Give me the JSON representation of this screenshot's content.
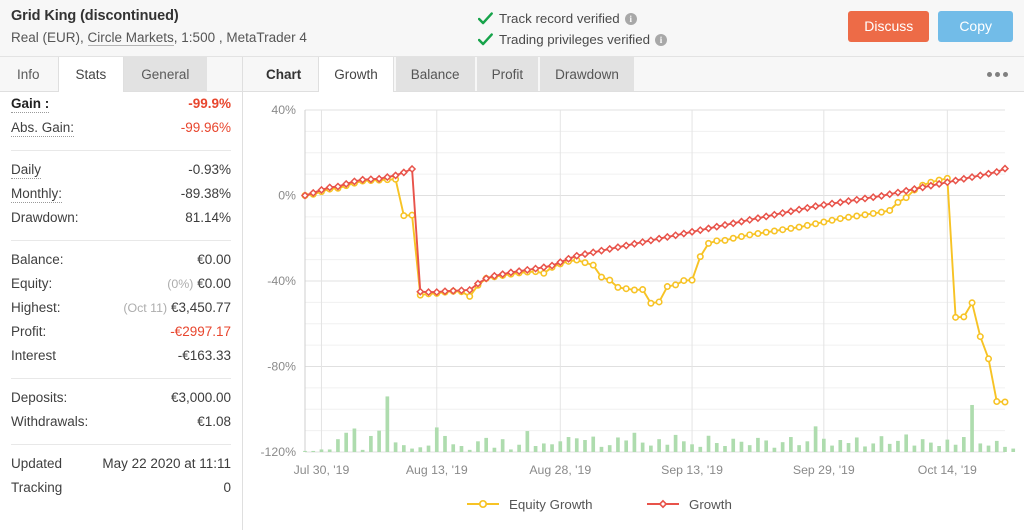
{
  "header": {
    "account_name": "Grid King (discontinued)",
    "account_type": "Real (EUR),",
    "broker": "Circle Markets",
    "account_meta": ", 1:500 , MetaTrader 4",
    "verified": [
      {
        "label": "Track record verified",
        "icon": "check-icon",
        "info": "i"
      },
      {
        "label": "Trading privileges verified",
        "icon": "check-icon",
        "info": "i"
      }
    ],
    "buttons": {
      "discuss": "Discuss",
      "copy": "Copy"
    },
    "colors": {
      "discuss_bg": "#ed6b47",
      "copy_bg": "#72bce8",
      "check_green": "#16a34a"
    }
  },
  "sidebar": {
    "tabs": [
      {
        "label": "Info",
        "state": "plain"
      },
      {
        "label": "Stats",
        "state": "active"
      },
      {
        "label": "General",
        "state": "shaded"
      }
    ],
    "groups": [
      {
        "rows": [
          {
            "label": "Gain :",
            "value": "-99.9%",
            "style": "redb",
            "label_style": "bold dotted"
          },
          {
            "label": "Abs. Gain:",
            "value": "-99.96%",
            "style": "red",
            "label_style": "dotted"
          }
        ]
      },
      {
        "rows": [
          {
            "label": "Daily",
            "value": "-0.93%",
            "style": "",
            "label_style": "dotted"
          },
          {
            "label": "Monthly:",
            "value": "-89.38%",
            "style": "",
            "label_style": "dotted"
          },
          {
            "label": "Drawdown:",
            "value": "81.14%",
            "style": "",
            "label_style": ""
          }
        ]
      },
      {
        "rows": [
          {
            "label": "Balance:",
            "value": "€0.00",
            "style": "",
            "label_style": ""
          },
          {
            "label": "Equity:",
            "value": "€0.00",
            "prefix": "(0%)",
            "style": "",
            "label_style": ""
          },
          {
            "label": "Highest:",
            "value": "€3,450.77",
            "prefix": "(Oct 11)",
            "style": "",
            "label_style": ""
          },
          {
            "label": "Profit:",
            "value": "-€2997.17",
            "style": "red",
            "label_style": ""
          },
          {
            "label": "Interest",
            "value": "-€163.33",
            "style": "",
            "label_style": ""
          }
        ]
      },
      {
        "rows": [
          {
            "label": "Deposits:",
            "value": "€3,000.00",
            "style": "",
            "label_style": ""
          },
          {
            "label": "Withdrawals:",
            "value": "€1.08",
            "style": "",
            "label_style": ""
          }
        ]
      },
      {
        "rows": [
          {
            "label": "Updated",
            "value": "May 22 2020 at 11:11",
            "style": "",
            "label_style": ""
          },
          {
            "label": "Tracking",
            "value": "0",
            "style": "",
            "label_style": ""
          }
        ]
      }
    ]
  },
  "chart_panel": {
    "tabs": [
      {
        "label": "Chart",
        "state": "first"
      },
      {
        "label": "Growth",
        "state": "active"
      },
      {
        "label": "Balance",
        "state": "shaded"
      },
      {
        "label": "Profit",
        "state": "shaded"
      },
      {
        "label": "Drawdown",
        "state": "shaded"
      }
    ],
    "menu_icon": "more-options-icon"
  },
  "chart_data": {
    "type": "line",
    "title": "",
    "xlabel": "",
    "ylabel": "",
    "ylim": [
      -120,
      40
    ],
    "yticks": [
      40,
      0,
      -40,
      -80,
      -120
    ],
    "ytick_labels": [
      "40%",
      "0%",
      "-40%",
      "-80%",
      "-120%"
    ],
    "grid": true,
    "legend_position": "bottom",
    "xtick_labels": [
      "Jul 30, '19",
      "Aug 13, '19",
      "Aug 28, '19",
      "Sep 13, '19",
      "Sep 29, '19",
      "Oct 14, '19"
    ],
    "xtick_indices": [
      2,
      16,
      31,
      47,
      63,
      78
    ],
    "n_points": 86,
    "series": [
      {
        "name": "Growth",
        "color": "#e8534a",
        "marker": "diamond",
        "values": [
          0.0,
          1.2,
          2.6,
          3.8,
          4.2,
          5.4,
          6.6,
          7.4,
          7.6,
          7.8,
          8.6,
          9.4,
          10.8,
          12.4,
          -45.0,
          -45.2,
          -45.2,
          -44.8,
          -44.6,
          -44.4,
          -44.2,
          -41.2,
          -38.8,
          -37.6,
          -36.8,
          -36.0,
          -35.4,
          -34.8,
          -34.2,
          -33.6,
          -32.8,
          -31.2,
          -29.6,
          -28.2,
          -27.4,
          -26.6,
          -25.8,
          -25.0,
          -24.2,
          -23.4,
          -22.6,
          -21.8,
          -21.0,
          -20.2,
          -19.4,
          -18.6,
          -17.8,
          -17.0,
          -16.2,
          -15.4,
          -14.6,
          -13.8,
          -13.0,
          -12.2,
          -11.4,
          -10.6,
          -9.8,
          -9.0,
          -8.2,
          -7.4,
          -6.6,
          -5.8,
          -5.0,
          -4.4,
          -3.8,
          -3.2,
          -2.6,
          -2.0,
          -1.4,
          -0.8,
          -0.2,
          0.6,
          1.4,
          2.2,
          3.0,
          3.8,
          4.6,
          5.4,
          6.2,
          7.0,
          7.8,
          8.6,
          9.4,
          10.2,
          11.0,
          12.6,
          13.2
        ]
      },
      {
        "name": "Equity Growth",
        "color": "#f7c325",
        "marker": "circle",
        "values": [
          0.0,
          0.6,
          1.8,
          3.0,
          3.4,
          4.6,
          5.8,
          6.8,
          7.0,
          7.2,
          7.4,
          7.6,
          -9.4,
          -9.2,
          -46.6,
          -46.0,
          -45.8,
          -45.2,
          -44.8,
          -45.0,
          -47.2,
          -42.0,
          -38.8,
          -38.0,
          -37.4,
          -36.8,
          -36.2,
          -35.8,
          -35.6,
          -36.4,
          -33.6,
          -32.0,
          -30.8,
          -30.2,
          -31.4,
          -32.6,
          -38.2,
          -39.6,
          -43.0,
          -43.6,
          -44.2,
          -44.0,
          -50.4,
          -49.8,
          -42.6,
          -41.8,
          -39.8,
          -39.6,
          -28.6,
          -22.4,
          -21.2,
          -21.0,
          -20.0,
          -19.2,
          -18.4,
          -17.8,
          -17.2,
          -16.6,
          -16.0,
          -15.4,
          -14.8,
          -14.0,
          -13.2,
          -12.4,
          -11.6,
          -10.8,
          -10.2,
          -9.6,
          -9.0,
          -8.4,
          -7.8,
          -7.0,
          -3.2,
          -1.0,
          2.6,
          4.8,
          6.2,
          7.2,
          8.0,
          8.8,
          9.6,
          10.4,
          11.2,
          11.6,
          4.6,
          -57.0
        ],
        "tail": [
          -57.0,
          -56.8,
          -50.2,
          -66.0,
          -76.4,
          -96.4,
          -96.6
        ]
      }
    ],
    "bars": {
      "name": "volume",
      "color": "#aedcae",
      "baseline": -120,
      "values": [
        0.5,
        0.5,
        1.2,
        1.2,
        6.0,
        9.0,
        11.0,
        1.0,
        7.5,
        10.0,
        26.0,
        4.5,
        3.2,
        1.6,
        2.2,
        3.0,
        11.5,
        7.5,
        3.6,
        2.8,
        1.0,
        5.0,
        6.6,
        2.0,
        6.0,
        1.2,
        3.4,
        9.8,
        2.8,
        4.0,
        3.6,
        5.0,
        7.0,
        6.4,
        5.6,
        7.2,
        2.4,
        3.2,
        6.8,
        5.4,
        9.0,
        4.4,
        3.0,
        6.0,
        3.4,
        8.0,
        5.0,
        3.6,
        2.4,
        7.6,
        4.2,
        2.8,
        6.2,
        4.8,
        3.2,
        6.6,
        5.4,
        2.0,
        4.6,
        7.0,
        3.2,
        5.0,
        12.0,
        6.2,
        3.0,
        5.6,
        4.2,
        6.8,
        2.6,
        4.0,
        7.4,
        3.8,
        5.2,
        8.2,
        3.0,
        6.0,
        4.4,
        2.8,
        5.8,
        3.4,
        7.0,
        22.0,
        4.0,
        3.0,
        5.2,
        2.4,
        1.6
      ]
    }
  }
}
